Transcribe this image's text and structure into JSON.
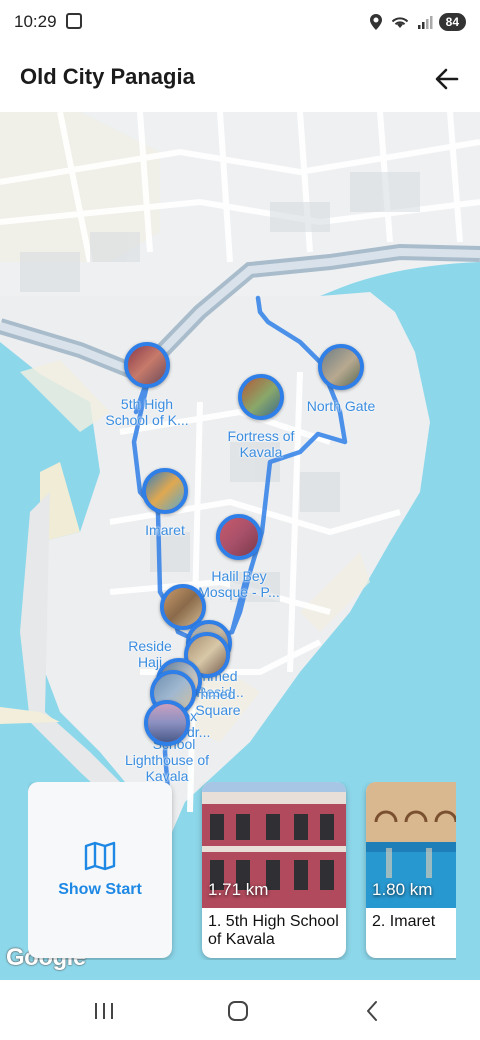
{
  "status": {
    "time": "10:29",
    "battery": "84",
    "icons": [
      "screenshot-icon",
      "location-icon",
      "wifi-icon",
      "signal-icon"
    ]
  },
  "header": {
    "title": "Old City Panagia",
    "back_icon": "arrow-back-icon"
  },
  "map": {
    "route_color": "#2f7fe8",
    "water_color": "#8cd7ea",
    "pois": [
      {
        "label": "5th High\nSchool of K..."
      },
      {
        "label": "North Gate"
      },
      {
        "label": "Fortress of\nKavala"
      },
      {
        "label": "Imaret"
      },
      {
        "label": "Halil Bey\nMosque - P..."
      },
      {
        "label": "Reside\nHaji"
      },
      {
        "label": "hmed\nResid..."
      },
      {
        "label": "hmed\nSquare"
      },
      {
        "label": "...dox\nCathedr..."
      },
      {
        "label": "School"
      },
      {
        "label": "Lighthouse of\nKavala"
      }
    ],
    "attribution": "Google"
  },
  "cards": {
    "start": {
      "label": "Show Start",
      "icon": "map-icon"
    },
    "places": [
      {
        "distance": "1.71 km",
        "name": "1. 5th High School of Kavala"
      },
      {
        "distance": "1.80 km",
        "name": "2. Imaret"
      }
    ]
  },
  "nav": {
    "recents_icon": "recent-apps-icon",
    "home_icon": "home-icon",
    "back_icon": "back-icon"
  }
}
